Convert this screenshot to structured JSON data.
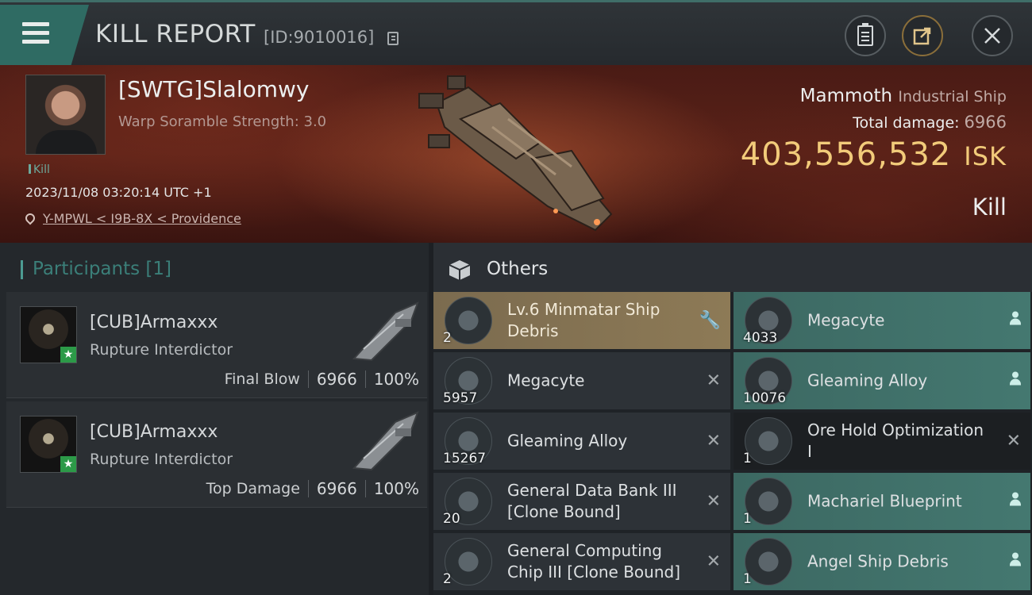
{
  "header": {
    "title": "KILL REPORT",
    "report_id": "[ID:9010016]",
    "icons": [
      "menu-icon",
      "copy-icon",
      "clipboard-icon",
      "share-icon",
      "close-icon"
    ]
  },
  "victim": {
    "name": "[SWTG]Slalomwy",
    "warp_scramble": "Warp Soramble Strength: 3.0",
    "tag": "Kill",
    "datetime": "2023/11/08 03:20:14 UTC +1",
    "location": "Y-MPWL < I9B-8X < Providence"
  },
  "ship": {
    "name": "Mammoth",
    "class": "Industrial Ship",
    "total_damage_label": "Total damage:",
    "total_damage": "6966",
    "isk_value": "403,556,532",
    "isk_unit": "ISK",
    "result": "Kill"
  },
  "participants": {
    "title": "Participants [1]",
    "cards": [
      {
        "name": "[CUB]Armaxxx",
        "ship": "Rupture Interdictor",
        "label": "Final Blow",
        "damage": "6966",
        "percent": "100%"
      },
      {
        "name": "[CUB]Armaxxx",
        "ship": "Rupture Interdictor",
        "label": "Top Damage",
        "damage": "6966",
        "percent": "100%"
      }
    ]
  },
  "others": {
    "title": "Others",
    "left_items": [
      {
        "name_line1": "Lv.6 Minmatar Ship",
        "name_line2": "Debris",
        "qty": "2",
        "mark": "wrench-icon",
        "style": "gold"
      },
      {
        "name_line1": "Megacyte",
        "name_line2": "",
        "qty": "5957",
        "mark": "x-icon",
        "style": "normal"
      },
      {
        "name_line1": "Gleaming Alloy",
        "name_line2": "",
        "qty": "15267",
        "mark": "x-icon",
        "style": "normal"
      },
      {
        "name_line1": "General Data Bank III",
        "name_line2": "[Clone Bound]",
        "qty": "20",
        "mark": "x-icon",
        "style": "normal"
      },
      {
        "name_line1": "General Computing",
        "name_line2": "Chip III [Clone Bound]",
        "qty": "2",
        "mark": "x-icon",
        "style": "normal"
      }
    ],
    "right_items": [
      {
        "name_line1": "Megacyte",
        "name_line2": "",
        "qty": "4033",
        "mark": "person-icon",
        "style": "teal"
      },
      {
        "name_line1": "Gleaming Alloy",
        "name_line2": "",
        "qty": "10076",
        "mark": "person-icon",
        "style": "teal"
      },
      {
        "name_line1": "Ore Hold Optimization",
        "name_line2": "I",
        "qty": "1",
        "mark": "x-icon",
        "style": "dark"
      },
      {
        "name_line1": "Machariel Blueprint",
        "name_line2": "",
        "qty": "1",
        "mark": "person-icon",
        "style": "teal"
      },
      {
        "name_line1": "Angel Ship Debris",
        "name_line2": "",
        "qty": "1",
        "mark": "person-icon",
        "style": "teal"
      }
    ]
  },
  "colors": {
    "accent_teal": "#3c6862",
    "gold": "#f2cb7a",
    "banner_red": "#5a2218"
  }
}
